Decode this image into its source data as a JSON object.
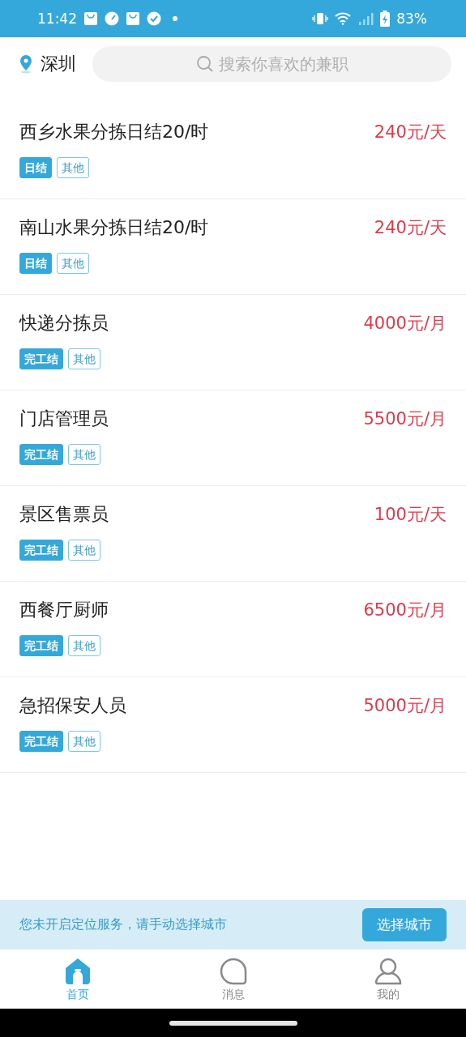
{
  "status_bar": {
    "time": "11:42",
    "battery": "83%"
  },
  "header": {
    "city": "深圳",
    "search": {
      "placeholder": "搜索你喜欢的兼职"
    }
  },
  "jobs": [
    {
      "title": "西乡水果分拣日结20/时",
      "pay": "240元/天",
      "tags": [
        {
          "label": "日结",
          "kind": "pay"
        },
        {
          "label": "其他",
          "kind": "other"
        }
      ]
    },
    {
      "title": "南山水果分拣日结20/时",
      "pay": "240元/天",
      "tags": [
        {
          "label": "日结",
          "kind": "pay"
        },
        {
          "label": "其他",
          "kind": "other"
        }
      ]
    },
    {
      "title": "快递分拣员",
      "pay": "4000元/月",
      "tags": [
        {
          "label": "完工结",
          "kind": "pay"
        },
        {
          "label": "其他",
          "kind": "other"
        }
      ]
    },
    {
      "title": "门店管理员",
      "pay": "5500元/月",
      "tags": [
        {
          "label": "完工结",
          "kind": "pay"
        },
        {
          "label": "其他",
          "kind": "other"
        }
      ]
    },
    {
      "title": "景区售票员",
      "pay": "100元/天",
      "tags": [
        {
          "label": "完工结",
          "kind": "pay"
        },
        {
          "label": "其他",
          "kind": "other"
        }
      ]
    },
    {
      "title": "西餐厅厨师",
      "pay": "6500元/月",
      "tags": [
        {
          "label": "完工结",
          "kind": "pay"
        },
        {
          "label": "其他",
          "kind": "other"
        }
      ]
    },
    {
      "title": "急招保安人员",
      "pay": "5000元/月",
      "tags": [
        {
          "label": "完工结",
          "kind": "pay"
        },
        {
          "label": "其他",
          "kind": "other"
        }
      ]
    }
  ],
  "location_banner": {
    "message": "您未开启定位服务，请手动选择城市",
    "button": "选择城市"
  },
  "tabs": [
    {
      "label": "首页",
      "kind": "home",
      "selected": true
    },
    {
      "label": "消息",
      "kind": "message",
      "selected": false
    },
    {
      "label": "我的",
      "kind": "user",
      "selected": false
    }
  ]
}
